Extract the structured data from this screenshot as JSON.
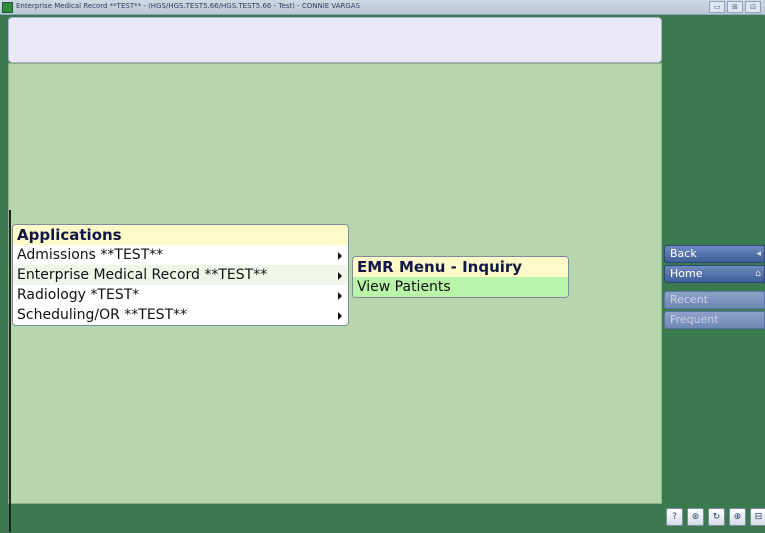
{
  "window": {
    "title": "Enterprise Medical Record **TEST** - (HGS/HGS.TEST5.66/HGS.TEST5.66 - Test) - CONNIE VARGAS",
    "controls": [
      "▭",
      "⊞",
      "⊡"
    ]
  },
  "applications_menu": {
    "title": "Applications",
    "items": [
      {
        "label": "Admissions  **TEST**"
      },
      {
        "label": "Enterprise Medical Record **TEST**"
      },
      {
        "label": "Radiology *TEST*"
      },
      {
        "label": "Scheduling/OR **TEST**"
      }
    ]
  },
  "emr_menu": {
    "title": "EMR Menu - Inquiry",
    "items": [
      {
        "label": "View Patients"
      }
    ]
  },
  "side_nav": {
    "back": "Back",
    "home": "Home",
    "recent": "Recent",
    "frequent": "Frequent",
    "back_indicator": "◂",
    "home_indicator": "⌂"
  },
  "bottom_icons": [
    {
      "name": "help-icon",
      "glyph": "?"
    },
    {
      "name": "search-icon",
      "glyph": "⊛"
    },
    {
      "name": "refresh-icon",
      "glyph": "↻"
    },
    {
      "name": "lock-icon",
      "glyph": "⊕"
    },
    {
      "name": "exit-icon",
      "glyph": "⊟"
    }
  ],
  "colors": {
    "background": "#3a7a4e",
    "panel": "#b6d7ae",
    "menu_header": "#fffbc8",
    "selected_item": "#b9f5a8",
    "nav_button": "#4a69a3"
  }
}
